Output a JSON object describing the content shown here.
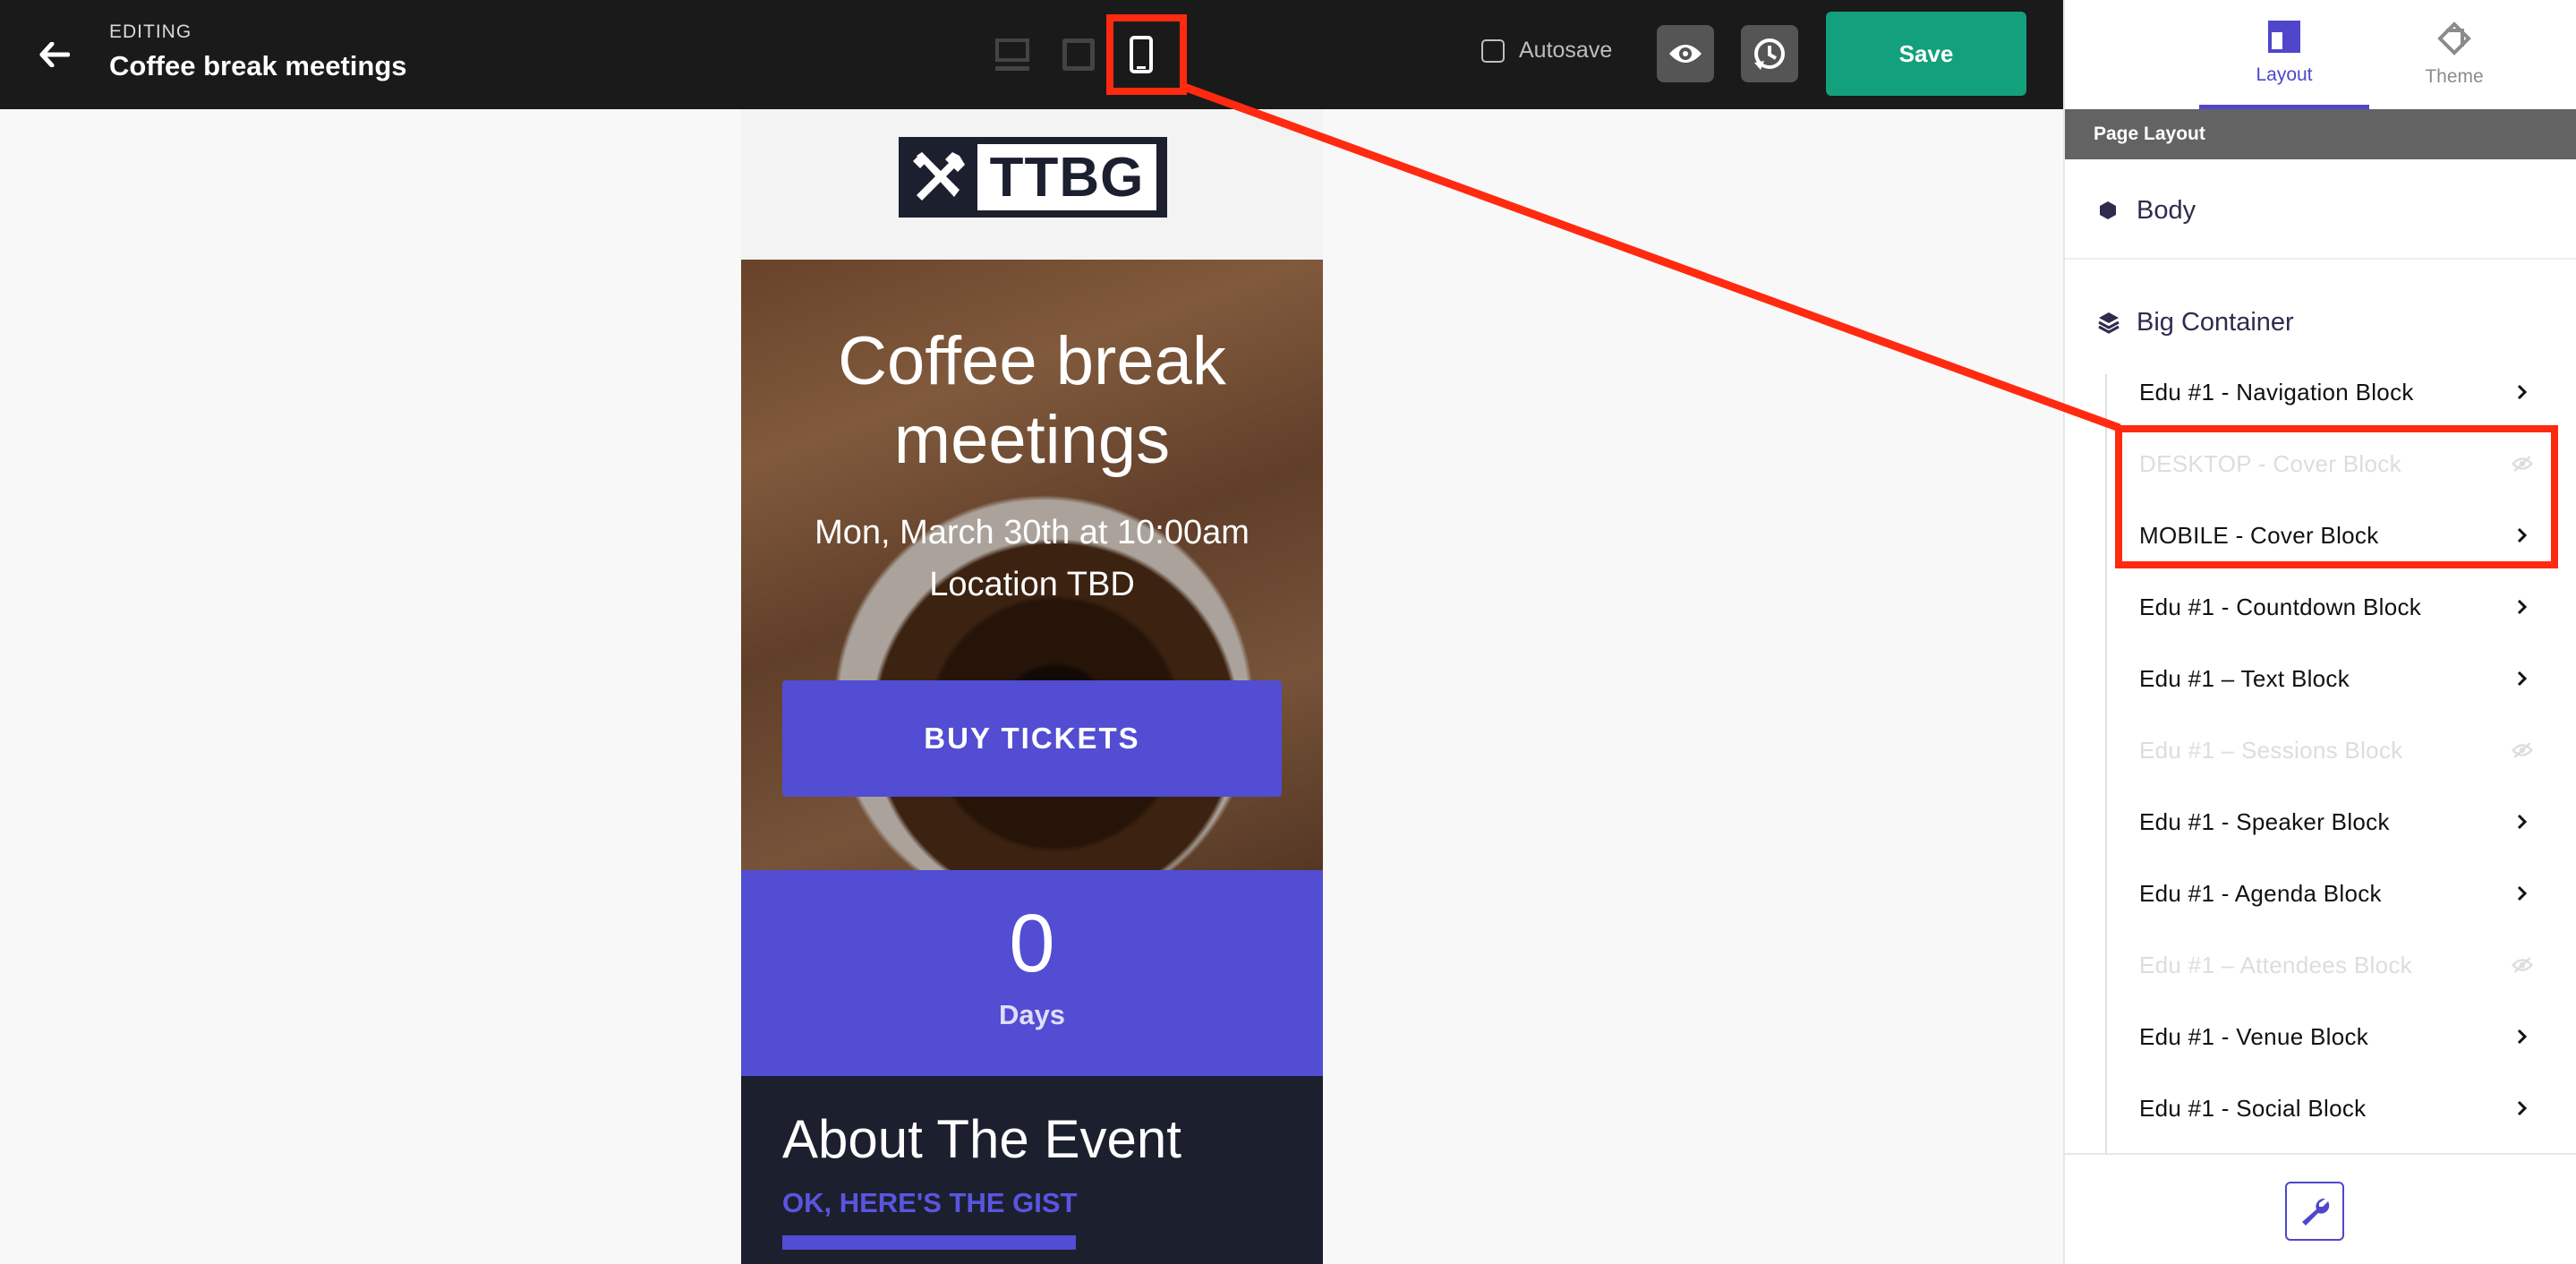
{
  "topbar": {
    "editing_label": "EDITING",
    "page_title": "Coffee break meetings",
    "autosave_label": "Autosave",
    "save_label": "Save"
  },
  "sidebar": {
    "tabs": [
      {
        "label": "Layout",
        "icon": "layout-icon",
        "active": true
      },
      {
        "label": "Theme",
        "icon": "theme-icon",
        "active": false
      }
    ],
    "section_header": "Page Layout",
    "body_label": "Body",
    "container_label": "Big Container",
    "items": [
      {
        "label": "Edu #1 - Navigation Block",
        "hidden": false
      },
      {
        "label": "DESKTOP - Cover Block",
        "hidden": true
      },
      {
        "label": "MOBILE - Cover Block",
        "hidden": false
      },
      {
        "label": "Edu #1 - Countdown Block",
        "hidden": false
      },
      {
        "label": "Edu #1 – Text Block",
        "hidden": false
      },
      {
        "label": "Edu #1 – Sessions Block",
        "hidden": true
      },
      {
        "label": "Edu #1 - Speaker Block",
        "hidden": false
      },
      {
        "label": "Edu #1 - Agenda Block",
        "hidden": false
      },
      {
        "label": "Edu #1 – Attendees Block",
        "hidden": true
      },
      {
        "label": "Edu #1 - Venue Block",
        "hidden": false
      },
      {
        "label": "Edu #1 - Social Block",
        "hidden": false
      }
    ]
  },
  "preview": {
    "logo_text": "TTBG",
    "cover_title": "Coffee break meetings",
    "cover_date": "Mon, March 30th at 10:00am",
    "cover_location": "Location TBD",
    "buy_button": "BUY TICKETS",
    "countdown_value": "0",
    "countdown_label": "Days",
    "about_title": "About The Event",
    "about_subtitle": "OK, HERE'S THE GIST"
  },
  "colors": {
    "accent": "#4f46cc",
    "save": "#13a07c",
    "annotation": "#ff2a10"
  }
}
